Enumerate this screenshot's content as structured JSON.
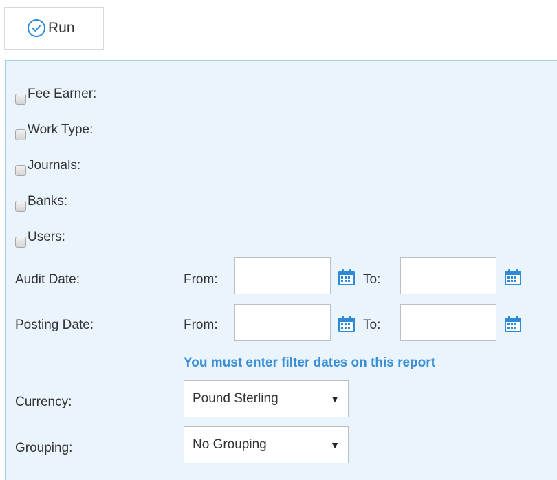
{
  "toolbar": {
    "run_label": "Run"
  },
  "filters": {
    "checkboxes": [
      {
        "label": "Fee Earner:"
      },
      {
        "label": "Work Type:"
      },
      {
        "label": "Journals:"
      },
      {
        "label": "Banks:"
      },
      {
        "label": "Users:"
      }
    ],
    "audit_date": {
      "label": "Audit Date:",
      "from_label": "From:",
      "to_label": "To:",
      "from_value": "",
      "to_value": ""
    },
    "posting_date": {
      "label": "Posting Date:",
      "from_label": "From:",
      "to_label": "To:",
      "from_value": "",
      "to_value": ""
    },
    "warning": "You must enter filter dates on this report",
    "currency": {
      "label": "Currency:",
      "selected": "Pound Sterling"
    },
    "grouping": {
      "label": "Grouping:",
      "selected": "No Grouping"
    }
  },
  "colors": {
    "panel_background": "#e9f4fc",
    "panel_border": "#a9cfe8",
    "accent": "#3a8ed6",
    "calendar_icon": "#2e8ad8"
  },
  "icons": {
    "run": "check-circle-icon",
    "date_picker": "calendar-icon",
    "dropdown": "caret-down-icon"
  }
}
